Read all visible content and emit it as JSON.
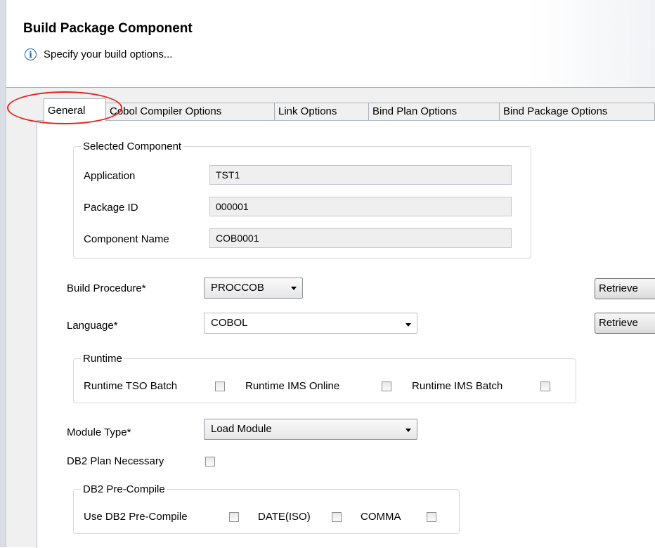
{
  "header": {
    "title": "Build Package Component",
    "subtitle": "Specify your build options...",
    "info_icon": "info-icon"
  },
  "tabs": [
    {
      "label": "General",
      "active": true
    },
    {
      "label": "Cobol Compiler Options",
      "active": false
    },
    {
      "label": "Link Options",
      "active": false
    },
    {
      "label": "Bind Plan Options",
      "active": false
    },
    {
      "label": "Bind Package Options",
      "active": false
    }
  ],
  "selected_component": {
    "legend": "Selected Component",
    "application_label": "Application",
    "application_value": "TST1",
    "package_id_label": "Package ID",
    "package_id_value": "000001",
    "component_name_label": "Component Name",
    "component_name_value": "COB0001"
  },
  "build_procedure": {
    "label": "Build Procedure*",
    "value": "PROCCOB",
    "retrieve_label": "Retrieve"
  },
  "language": {
    "label": "Language*",
    "value": "COBOL",
    "retrieve_label": "Retrieve"
  },
  "runtime": {
    "legend": "Runtime",
    "tso_batch_label": "Runtime TSO Batch",
    "tso_batch_checked": false,
    "ims_online_label": "Runtime IMS Online",
    "ims_online_checked": false,
    "ims_batch_label": "Runtime IMS Batch",
    "ims_batch_checked": false
  },
  "module_type": {
    "label": "Module Type*",
    "value": "Load Module"
  },
  "db2_plan": {
    "label": "DB2 Plan Necessary",
    "checked": false
  },
  "db2_precompile": {
    "legend": "DB2 Pre-Compile",
    "use_label": "Use DB2 Pre-Compile",
    "use_checked": false,
    "date_label": "DATE(ISO)",
    "date_checked": false,
    "comma_label": "COMMA",
    "comma_checked": false
  },
  "colors": {
    "annotation": "#e2231a",
    "info_blue": "#1a5fb4"
  }
}
